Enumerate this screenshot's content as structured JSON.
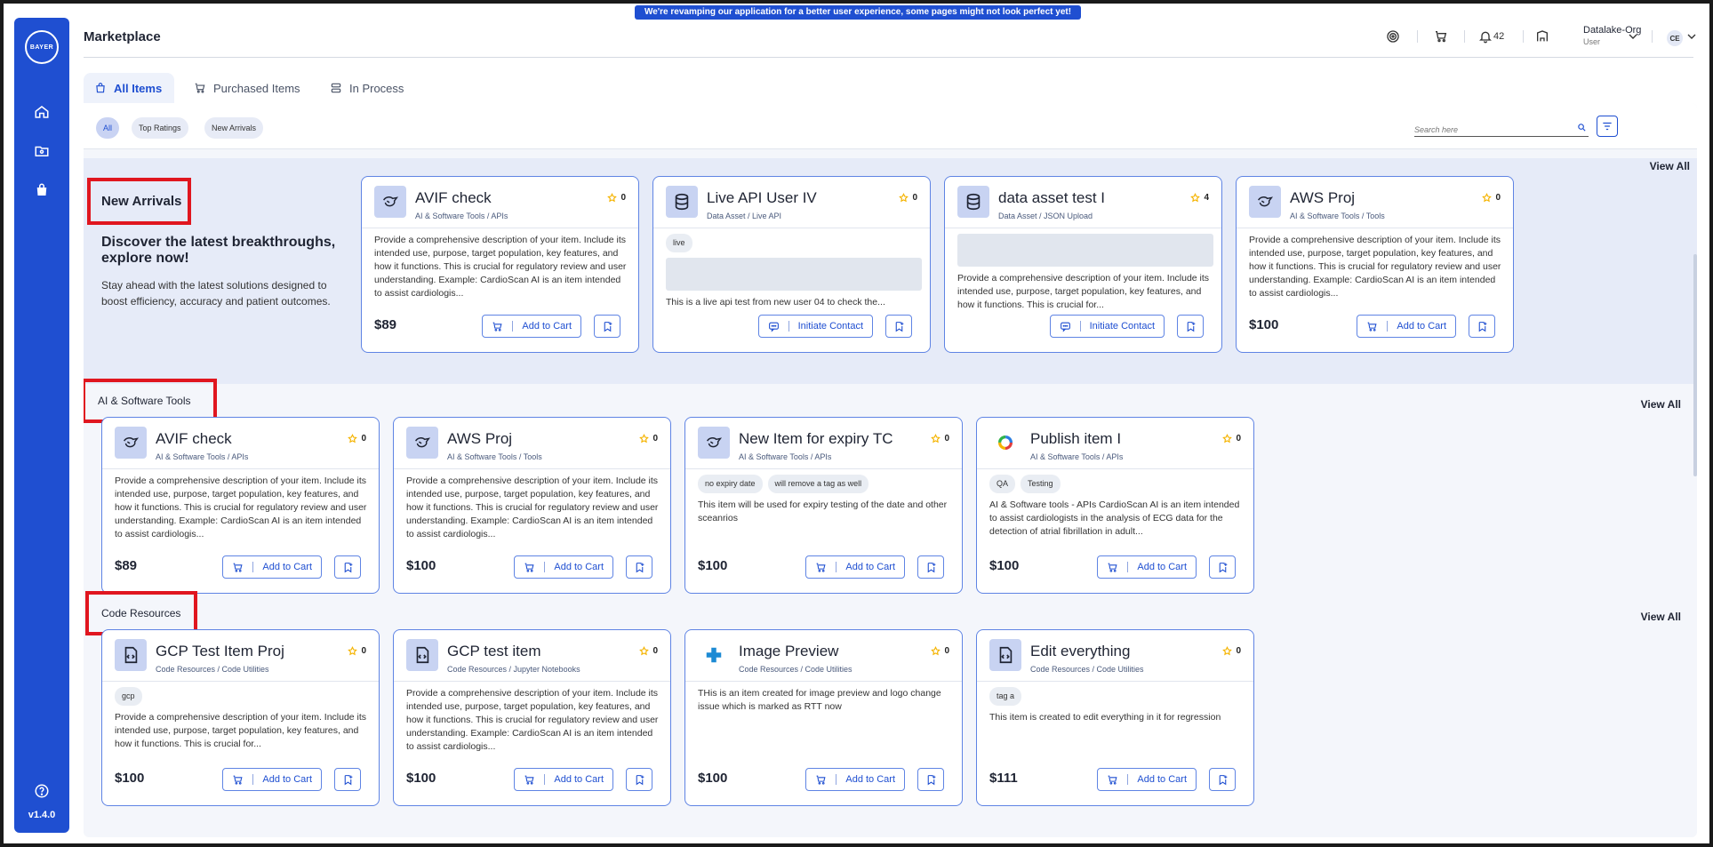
{
  "banner": "We're revamping our application for a better user experience, some pages might not look perfect yet!",
  "page_title": "Marketplace",
  "logo_text": "BAYER",
  "version": "v1.4.0",
  "header": {
    "notifications_count": "42",
    "org_name": "Datalake-Org",
    "org_role": "User",
    "avatar_initials": "CE"
  },
  "tabs": [
    {
      "label": "All Items",
      "active": true
    },
    {
      "label": "Purchased Items",
      "active": false
    },
    {
      "label": "In Process",
      "active": false
    }
  ],
  "filters": {
    "chips": [
      "All",
      "Top Ratings",
      "New Arrivals"
    ],
    "search_placeholder": "Search here"
  },
  "new_arrivals": {
    "title": "New Arrivals",
    "headline": "Discover the latest breakthroughs, explore now!",
    "description": "Stay ahead with the latest solutions designed to boost efficiency, accuracy and patient outcomes.",
    "view_all": "View All",
    "cards": [
      {
        "title": "AVIF check",
        "subtitle": "AI & Software Tools / APIs",
        "rating": "0",
        "body": "Provide a comprehensive description of your item. Include its intended use, purpose, target population, key features, and how it functions. This is crucial for regulatory review and user understanding. Example: CardioScan AI is an item intended to assist cardiologis...",
        "price": "$89",
        "action": "Add to Cart"
      },
      {
        "title": "Live API User IV",
        "subtitle": "Data Asset / Live API",
        "rating": "0",
        "tags": [
          "live"
        ],
        "body": "This is a live api test from new user 04 to check the...",
        "action": "Initiate Contact"
      },
      {
        "title": "data asset test I",
        "subtitle": "Data Asset / JSON Upload",
        "rating": "4",
        "body": "Provide a comprehensive description of your item. Include its intended use, purpose, target population, key features, and how it functions. This is crucial for...",
        "action": "Initiate Contact"
      },
      {
        "title": "AWS Proj",
        "subtitle": "AI & Software Tools / Tools",
        "rating": "0",
        "body": "Provide a comprehensive description of your item. Include its intended use, purpose, target population, key features, and how it functions. This is crucial for regulatory review and user understanding. Example: CardioScan AI is an item intended to assist cardiologis...",
        "price": "$100",
        "action": "Add to Cart"
      }
    ]
  },
  "ai_tools": {
    "title": "AI & Software Tools",
    "view_all": "View All",
    "cards": [
      {
        "title": "AVIF check",
        "subtitle": "AI & Software Tools / APIs",
        "rating": "0",
        "body": "Provide a comprehensive description of your item. Include its intended use, purpose, target population, key features, and how it functions. This is crucial for regulatory review and user understanding. Example: CardioScan AI is an item intended to assist cardiologis...",
        "price": "$89",
        "action": "Add to Cart"
      },
      {
        "title": "AWS Proj",
        "subtitle": "AI & Software Tools / Tools",
        "rating": "0",
        "body": "Provide a comprehensive description of your item. Include its intended use, purpose, target population, key features, and how it functions. This is crucial for regulatory review and user understanding. Example: CardioScan AI is an item intended to assist cardiologis...",
        "price": "$100",
        "action": "Add to Cart"
      },
      {
        "title": "New Item for expiry TC",
        "subtitle": "AI & Software Tools / APIs",
        "rating": "0",
        "tags": [
          "no expiry date",
          "will remove a tag as well"
        ],
        "body": "This item will be used for expiry testing of the date and other sceanrios",
        "price": "$100",
        "action": "Add to Cart"
      },
      {
        "title": "Publish item I",
        "subtitle": "AI & Software Tools / APIs",
        "rating": "0",
        "tags": [
          "QA",
          "Testing"
        ],
        "body": "AI & Software tools - APIs CardioScan AI is an item intended to assist cardiologists in the analysis of ECG data for the detection of atrial fibrillation in adult...",
        "price": "$100",
        "action": "Add to Cart"
      }
    ]
  },
  "code_resources": {
    "title": "Code Resources",
    "view_all": "View All",
    "cards": [
      {
        "title": "GCP Test Item Proj",
        "subtitle": "Code Resources / Code Utilities",
        "rating": "0",
        "tags": [
          "gcp"
        ],
        "body": "Provide a comprehensive description of your item. Include its intended use, purpose, target population, key features, and how it functions. This is crucial for...",
        "price": "$100",
        "action": "Add to Cart"
      },
      {
        "title": "GCP test item",
        "subtitle": "Code Resources / Jupyter Notebooks",
        "rating": "0",
        "body": "Provide a comprehensive description of your item. Include its intended use, purpose, target population, key features, and how it functions. This is crucial for regulatory review and user understanding. Example: CardioScan AI is an item intended to assist cardiologis...",
        "price": "$100",
        "action": "Add to Cart"
      },
      {
        "title": "Image Preview",
        "subtitle": "Code Resources / Code Utilities",
        "rating": "0",
        "body": "THis is an item created for image preview and logo change issue which is marked as RTT now",
        "price": "$100",
        "action": "Add to Cart"
      },
      {
        "title": "Edit everything",
        "subtitle": "Code Resources / Code Utilities",
        "rating": "0",
        "tags": [
          "tag a"
        ],
        "body": "This item is created to edit everything in it for regression",
        "price": "$111",
        "action": "Add to Cart"
      }
    ]
  }
}
